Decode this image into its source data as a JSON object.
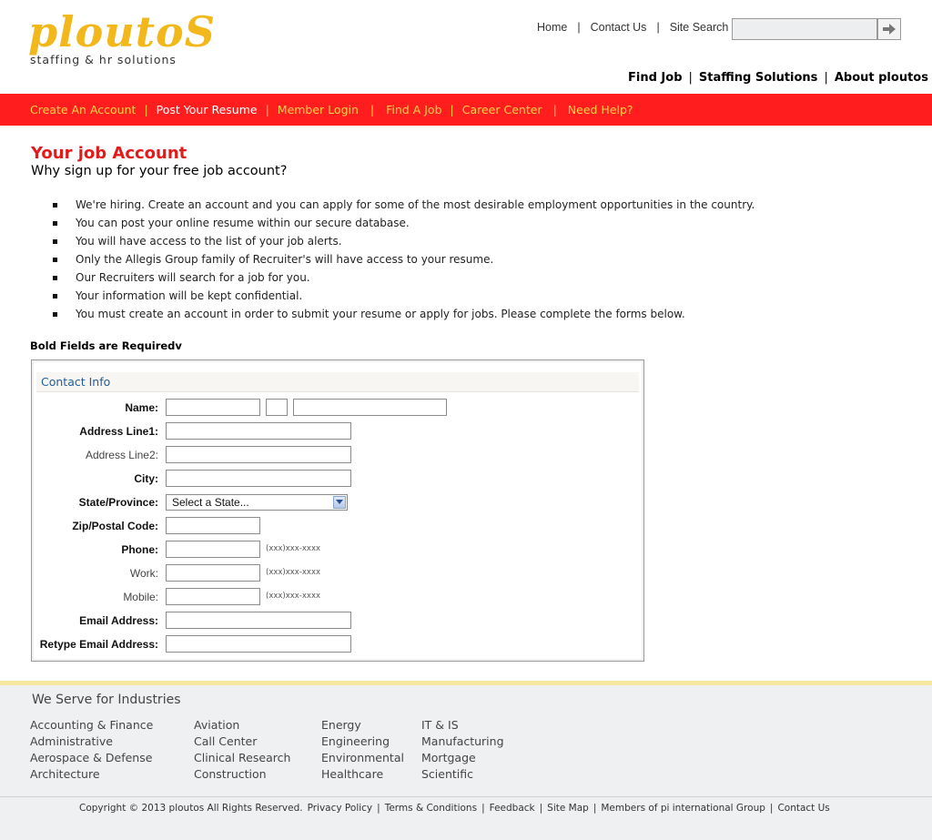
{
  "logo": {
    "word": "ploutoS",
    "tagline": "staffing & hr solutions"
  },
  "toplinks": [
    {
      "label": "Home"
    },
    {
      "label": "Contact Us"
    },
    {
      "label": "Site Search"
    }
  ],
  "search": {
    "value": "",
    "button_icon": "arrow-right-icon"
  },
  "mainnav": [
    {
      "label": "Find Job"
    },
    {
      "label": "Staffing Solutions"
    },
    {
      "label": "About ploutos"
    }
  ],
  "redbar": [
    {
      "label": "Create An Account",
      "active": false
    },
    {
      "label": "Post Your Resume",
      "active": true
    },
    {
      "label": "Member Login",
      "active": false
    },
    {
      "label": "Find A Job",
      "active": false
    },
    {
      "label": "Career Center",
      "active": false
    },
    {
      "label": "Need Help?",
      "active": false
    }
  ],
  "content": {
    "title": "Your job Account",
    "subtitle": "Why sign up for your free job account?",
    "bullets": [
      "We're hiring. Create an account and you can apply for some of the most desirable employment opportunities in the country.",
      "You can post your online resume within our secure database.",
      "You will have access to the list of your job alerts.",
      "Only the Allegis Group family of Recruiter's will have access to your resume.",
      "Our Recruiters will search for a job for you.",
      "Your information will be kept confidential.",
      "You must create an account in order to submit your resume or apply for jobs. Please complete the forms below."
    ],
    "required_note": "Bold Fields are Requiredv"
  },
  "form": {
    "section_title": "Contact Info",
    "labels": {
      "name": "Name:",
      "address1": "Address Line1:",
      "address2": "Address Line2:",
      "city": "City:",
      "state": "State/Province:",
      "zip": "Zip/Postal Code:",
      "phone": "Phone:",
      "work": "Work:",
      "mobile": "Mobile:",
      "email": "Email Address:",
      "retype_email": "Retype Email Address:"
    },
    "state_selected": "Select a State...",
    "phone_hint": "(xxx)xxx-xxxx"
  },
  "footer": {
    "industries_title": "We Serve for Industries",
    "columns": [
      [
        "Accounting & Finance",
        "Administrative",
        "Aerospace & Defense",
        "Architecture"
      ],
      [
        "Aviation",
        "Call Center",
        "Clinical Research",
        "Construction"
      ],
      [
        "Energy",
        "Engineering",
        "Environmental",
        "Healthcare"
      ],
      [
        "IT & IS",
        "Manufacturing",
        "Mortgage",
        "Scientific"
      ]
    ],
    "copyright": "Copyright © 2013 ploutos All Rights Reserved.",
    "links": [
      "Privacy Policy",
      "Terms & Conditions",
      "Feedback",
      "Site Map",
      "Members of pi international Group",
      "Contact Us"
    ]
  },
  "colors": {
    "brand_red": "#ff1d1d",
    "brand_yellow": "#f2b81b",
    "title_red": "#e41a1a",
    "link_blue": "#1f5e99"
  }
}
